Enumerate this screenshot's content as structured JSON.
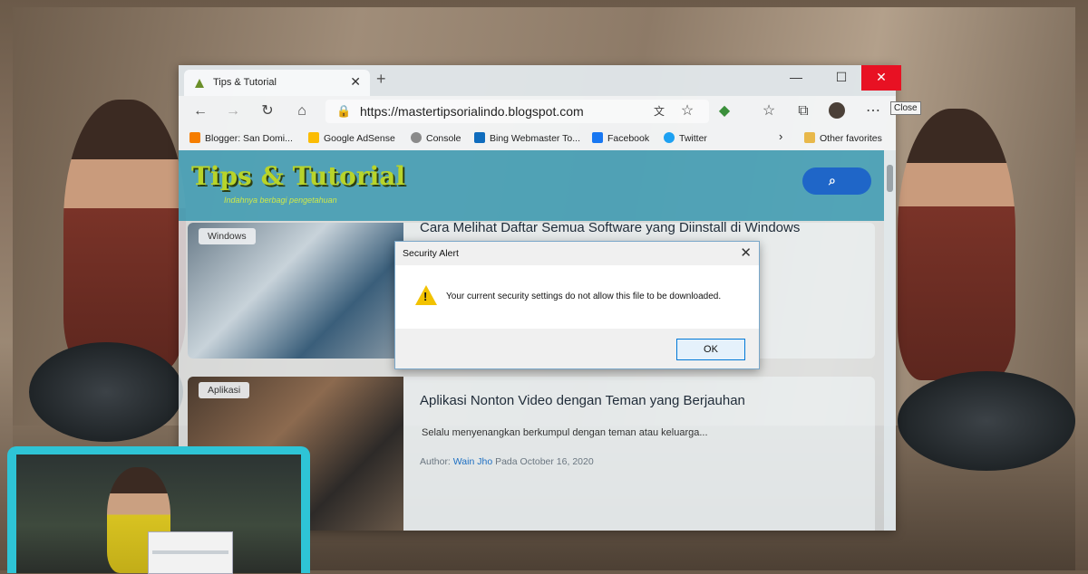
{
  "browser": {
    "tab_title": "Tips & Tutorial",
    "new_tab_symbol": "+",
    "window_controls": {
      "minimize": "—",
      "maximize": "☐",
      "close": "✕"
    },
    "tooltip": "Close",
    "url": "https://mastertipsorialindo.blogspot.com",
    "favorites": [
      {
        "label": "Blogger: San Domi...",
        "icon": "blogger-icon",
        "color": "#f57d00"
      },
      {
        "label": "Google AdSense",
        "icon": "adsense-icon",
        "color": "#fbbc04"
      },
      {
        "label": "Console",
        "icon": "console-icon",
        "color": "#777777"
      },
      {
        "label": "Bing Webmaster To...",
        "icon": "bing-icon",
        "color": "#0f6cbd"
      },
      {
        "label": "Facebook",
        "icon": "facebook-icon",
        "color": "#1877f2"
      },
      {
        "label": "Twitter",
        "icon": "twitter-icon",
        "color": "#1da1f2"
      }
    ],
    "other_favorites": "Other favorites"
  },
  "site": {
    "logo": "Tips & Tutorial",
    "tagline": "Indahnya berbagi pengetahuan",
    "search_icon": "search-icon",
    "posts": [
      {
        "category": "Windows",
        "title": "Cara Melihat Daftar Semua Software yang Diinstall di Windows",
        "excerpt": "",
        "author_label": "",
        "author": "",
        "date": ""
      },
      {
        "category": "Aplikasi",
        "title": "Aplikasi Nonton Video dengan Teman yang Berjauhan",
        "excerpt": "Selalu menyenangkan berkumpul dengan teman atau keluarga...",
        "author_label": "Author:",
        "author": "Wain Jho",
        "date": "Pada October 16, 2020"
      }
    ]
  },
  "dialog": {
    "title": "Security Alert",
    "message": "Your current security settings do not allow this file to be downloaded.",
    "ok": "OK",
    "close": "✕",
    "warn_mark": "!"
  },
  "colors": {
    "accent": "#1f66c8",
    "header": "#1c8ca8",
    "close_red": "#e81123",
    "laptop": "#2ec4d6"
  }
}
